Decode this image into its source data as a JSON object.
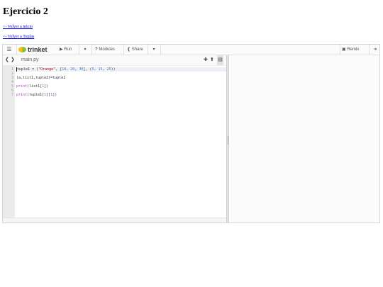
{
  "page": {
    "title": "Ejercicio 2",
    "links": [
      {
        "label": "<- Volver a inicio"
      },
      {
        "label": "<- Volver a Tuplas"
      }
    ]
  },
  "toolbar": {
    "menu_icon": "bars-icon",
    "logo_text": "trinket",
    "run_label": "Run",
    "modules_label": "Modules",
    "share_label": "Share",
    "remix_label": "Remix"
  },
  "editor": {
    "filename": "main.py",
    "line_numbers": [
      "1",
      "2",
      "3",
      "4",
      "5",
      "6",
      "7"
    ],
    "lines": [
      "tuple1 = (\"Orange\", [10, 20, 30], (5, 15, 25))",
      "",
      "(a,list1,tuple2)=tuple1",
      "",
      "print(list1[1])",
      "",
      "print(tuple1[1][1])"
    ]
  },
  "colors": {
    "accent_yellow": "#f5c10e",
    "accent_green": "#88bf3b",
    "keyword": "#b43cc4",
    "string": "#aa1111",
    "number": "#3a7fd6",
    "link": "#0000ee"
  }
}
